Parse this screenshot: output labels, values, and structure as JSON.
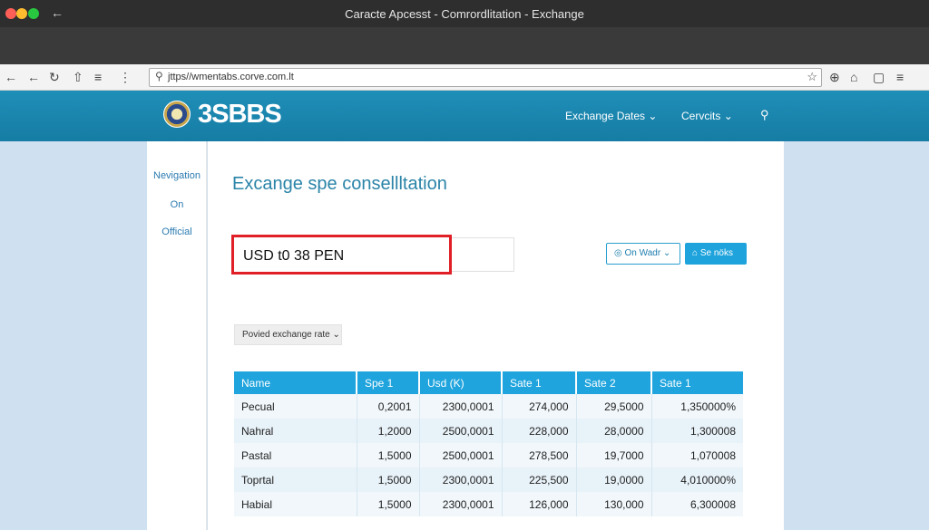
{
  "window": {
    "title": "Caracte Apcesst - Comrordlitation - Exchange"
  },
  "toolbar": {
    "url": "jttps//wmentabs.corve.com.lt",
    "icons": [
      "back-icon",
      "forward-icon",
      "reload-icon",
      "share-icon",
      "menu-icon",
      "more-icon",
      "star-icon",
      "extension-icon",
      "home-icon",
      "bookmark-icon",
      "hamburger-icon"
    ]
  },
  "header": {
    "logo_text": "3SBBS",
    "nav": [
      {
        "label": "Exchange Dates"
      },
      {
        "label": "Cervcits"
      }
    ]
  },
  "sidebar": {
    "items": [
      {
        "label": "Nevigation"
      },
      {
        "label": "On"
      },
      {
        "label": "Official"
      }
    ]
  },
  "main": {
    "title": "Excange spe consellltation",
    "conversion_value": "USD t0 38 PEN",
    "outline_button": "On Wadr",
    "primary_button": "Se nöks",
    "rate_dropdown": "Povied exchange rate"
  },
  "table": {
    "columns": [
      "Name",
      "Spe 1",
      "Usd (K)",
      "Sate 1",
      "Sate 2",
      "Sate 1"
    ],
    "rows": [
      [
        "Pecual",
        "0,2001",
        "2300,0001",
        "274,000",
        "29,5000",
        "1,350000%"
      ],
      [
        "Nahral",
        "1,2000",
        "2500,0001",
        "228,000",
        "28,0000",
        "1,300008"
      ],
      [
        "Pastal",
        "1,5000",
        "2500,0001",
        "278,500",
        "19,7000",
        "1,070008"
      ],
      [
        "Toprtal",
        "1,5000",
        "2300,0001",
        "225,500",
        "19,0000",
        "4,010000%"
      ],
      [
        "Habial",
        "1,5000",
        "2300,0001",
        "126,000",
        "130,000",
        "6,300008"
      ]
    ]
  },
  "colors": {
    "header_blue": "#1a87b0",
    "accent": "#1ea3dc",
    "highlight_red": "#e01f26"
  }
}
